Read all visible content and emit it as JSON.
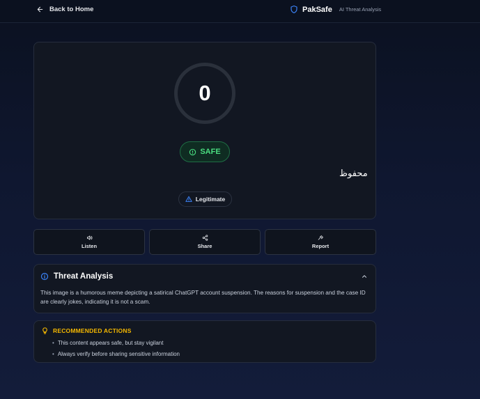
{
  "header": {
    "back_label": "Back to Home",
    "brand_name": "PakSafe",
    "brand_subtitle": "AI Threat Analysis"
  },
  "score": {
    "value": "0",
    "status_label": "SAFE",
    "status_color": "#4ade80",
    "urdu_label": "محفوظ",
    "category_label": "Legitimate"
  },
  "actions": {
    "listen": "Listen",
    "share": "Share",
    "report": "Report"
  },
  "analysis": {
    "title": "Threat Analysis",
    "text": "This image is a humorous meme depicting a satirical ChatGPT account suspension. The reasons for suspension and the case ID are clearly jokes, indicating it is not a scam."
  },
  "recommended": {
    "title": "RECOMMENDED ACTIONS",
    "items": [
      "This content appears safe, but stay vigilant",
      "Always verify before sharing sensitive information"
    ]
  },
  "colors": {
    "accent_blue": "#3b82f6",
    "safe_green": "#4ade80",
    "warning_yellow": "#f5b800"
  }
}
